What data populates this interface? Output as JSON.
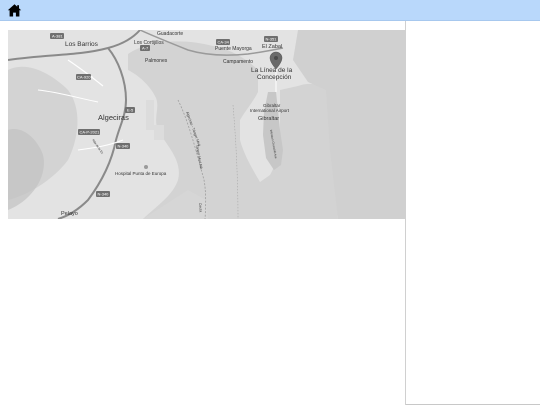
{
  "header": {
    "home_icon": "home-icon",
    "accent_color": "#b9d8fb"
  },
  "map": {
    "places": {
      "los_barrios": "Los Barrios",
      "los_cortijillos": "Los Cortijillos",
      "guadacorte": "Guadacorte",
      "palmones": "Palmones",
      "puente_mayorga": "Puente Mayorga",
      "campamento": "Campamento",
      "el_zabal": "El Zabal",
      "la_linea_1": "La Línea de la",
      "la_linea_2": "Concepción",
      "gibraltar_airport_1": "Gibraltar",
      "gibraltar_airport_2": "International Airport",
      "gibraltar": "Gibraltar",
      "algeciras": "Algeciras",
      "hospital": "Hospital Punta de Europa",
      "pelayo": "Pelayo"
    },
    "road_shields": {
      "a381": "A-381",
      "ca9207": "CA-9207",
      "a7": "A-7",
      "ca34": "CA-34",
      "n351": "N-351",
      "ca34b": "CA-34",
      "e5": "E-5",
      "ca_p2021": "CA-P-2021",
      "n340": "N-340",
      "n340b": "N-340"
    },
    "water_labels": {
      "ferry1": "Algeciras - Tánger Med",
      "ferry2": "Tanger Med MA",
      "ferry3": "Ceuta"
    },
    "street_labels": {
      "rdas": "Rda de la Ex",
      "winston": "Winston Churchill Ave"
    },
    "marker_icon": "map-pin-icon"
  }
}
